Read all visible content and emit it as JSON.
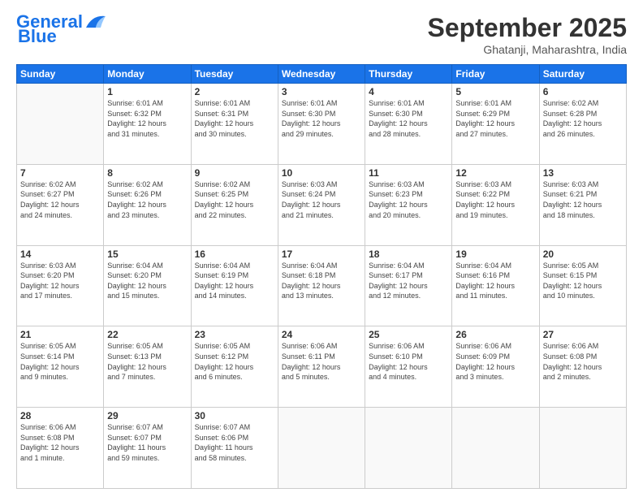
{
  "header": {
    "logo_line1": "General",
    "logo_line2": "Blue",
    "month": "September 2025",
    "location": "Ghatanji, Maharashtra, India"
  },
  "weekdays": [
    "Sunday",
    "Monday",
    "Tuesday",
    "Wednesday",
    "Thursday",
    "Friday",
    "Saturday"
  ],
  "weeks": [
    [
      {
        "day": "",
        "info": ""
      },
      {
        "day": "1",
        "info": "Sunrise: 6:01 AM\nSunset: 6:32 PM\nDaylight: 12 hours\nand 31 minutes."
      },
      {
        "day": "2",
        "info": "Sunrise: 6:01 AM\nSunset: 6:31 PM\nDaylight: 12 hours\nand 30 minutes."
      },
      {
        "day": "3",
        "info": "Sunrise: 6:01 AM\nSunset: 6:30 PM\nDaylight: 12 hours\nand 29 minutes."
      },
      {
        "day": "4",
        "info": "Sunrise: 6:01 AM\nSunset: 6:30 PM\nDaylight: 12 hours\nand 28 minutes."
      },
      {
        "day": "5",
        "info": "Sunrise: 6:01 AM\nSunset: 6:29 PM\nDaylight: 12 hours\nand 27 minutes."
      },
      {
        "day": "6",
        "info": "Sunrise: 6:02 AM\nSunset: 6:28 PM\nDaylight: 12 hours\nand 26 minutes."
      }
    ],
    [
      {
        "day": "7",
        "info": "Sunrise: 6:02 AM\nSunset: 6:27 PM\nDaylight: 12 hours\nand 24 minutes."
      },
      {
        "day": "8",
        "info": "Sunrise: 6:02 AM\nSunset: 6:26 PM\nDaylight: 12 hours\nand 23 minutes."
      },
      {
        "day": "9",
        "info": "Sunrise: 6:02 AM\nSunset: 6:25 PM\nDaylight: 12 hours\nand 22 minutes."
      },
      {
        "day": "10",
        "info": "Sunrise: 6:03 AM\nSunset: 6:24 PM\nDaylight: 12 hours\nand 21 minutes."
      },
      {
        "day": "11",
        "info": "Sunrise: 6:03 AM\nSunset: 6:23 PM\nDaylight: 12 hours\nand 20 minutes."
      },
      {
        "day": "12",
        "info": "Sunrise: 6:03 AM\nSunset: 6:22 PM\nDaylight: 12 hours\nand 19 minutes."
      },
      {
        "day": "13",
        "info": "Sunrise: 6:03 AM\nSunset: 6:21 PM\nDaylight: 12 hours\nand 18 minutes."
      }
    ],
    [
      {
        "day": "14",
        "info": "Sunrise: 6:03 AM\nSunset: 6:20 PM\nDaylight: 12 hours\nand 17 minutes."
      },
      {
        "day": "15",
        "info": "Sunrise: 6:04 AM\nSunset: 6:20 PM\nDaylight: 12 hours\nand 15 minutes."
      },
      {
        "day": "16",
        "info": "Sunrise: 6:04 AM\nSunset: 6:19 PM\nDaylight: 12 hours\nand 14 minutes."
      },
      {
        "day": "17",
        "info": "Sunrise: 6:04 AM\nSunset: 6:18 PM\nDaylight: 12 hours\nand 13 minutes."
      },
      {
        "day": "18",
        "info": "Sunrise: 6:04 AM\nSunset: 6:17 PM\nDaylight: 12 hours\nand 12 minutes."
      },
      {
        "day": "19",
        "info": "Sunrise: 6:04 AM\nSunset: 6:16 PM\nDaylight: 12 hours\nand 11 minutes."
      },
      {
        "day": "20",
        "info": "Sunrise: 6:05 AM\nSunset: 6:15 PM\nDaylight: 12 hours\nand 10 minutes."
      }
    ],
    [
      {
        "day": "21",
        "info": "Sunrise: 6:05 AM\nSunset: 6:14 PM\nDaylight: 12 hours\nand 9 minutes."
      },
      {
        "day": "22",
        "info": "Sunrise: 6:05 AM\nSunset: 6:13 PM\nDaylight: 12 hours\nand 7 minutes."
      },
      {
        "day": "23",
        "info": "Sunrise: 6:05 AM\nSunset: 6:12 PM\nDaylight: 12 hours\nand 6 minutes."
      },
      {
        "day": "24",
        "info": "Sunrise: 6:06 AM\nSunset: 6:11 PM\nDaylight: 12 hours\nand 5 minutes."
      },
      {
        "day": "25",
        "info": "Sunrise: 6:06 AM\nSunset: 6:10 PM\nDaylight: 12 hours\nand 4 minutes."
      },
      {
        "day": "26",
        "info": "Sunrise: 6:06 AM\nSunset: 6:09 PM\nDaylight: 12 hours\nand 3 minutes."
      },
      {
        "day": "27",
        "info": "Sunrise: 6:06 AM\nSunset: 6:08 PM\nDaylight: 12 hours\nand 2 minutes."
      }
    ],
    [
      {
        "day": "28",
        "info": "Sunrise: 6:06 AM\nSunset: 6:08 PM\nDaylight: 12 hours\nand 1 minute."
      },
      {
        "day": "29",
        "info": "Sunrise: 6:07 AM\nSunset: 6:07 PM\nDaylight: 11 hours\nand 59 minutes."
      },
      {
        "day": "30",
        "info": "Sunrise: 6:07 AM\nSunset: 6:06 PM\nDaylight: 11 hours\nand 58 minutes."
      },
      {
        "day": "",
        "info": ""
      },
      {
        "day": "",
        "info": ""
      },
      {
        "day": "",
        "info": ""
      },
      {
        "day": "",
        "info": ""
      }
    ]
  ]
}
